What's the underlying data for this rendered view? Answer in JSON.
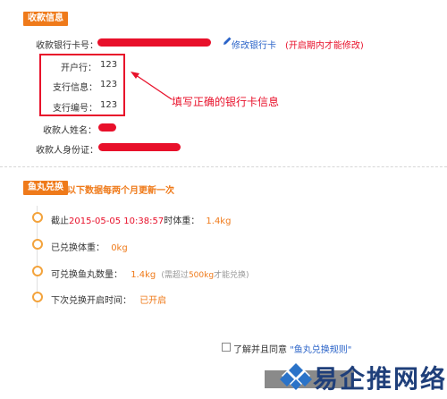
{
  "receiving_info": {
    "section_title": "收款信息",
    "bank_card_label": "收款银行卡号：",
    "modify_link": "修改银行卡",
    "modify_note": "(开启期内才能修改)",
    "bank_open_label": "开户行：",
    "bank_open_value": "123",
    "branch_info_label": "支行信息：",
    "branch_info_value": "123",
    "branch_code_label": "支行编号：",
    "branch_code_value": "123",
    "annotation": "填写正确的银行卡信息",
    "payee_name_label": "收款人姓名：",
    "payee_id_label": "收款人身份证："
  },
  "fish_exchange": {
    "section_title": "鱼丸兑换",
    "notice": "以下数据每两个月更新一次",
    "items": [
      {
        "prefix": "截止",
        "date": "2015-05-05 10:38:57",
        "mid": "时体重：",
        "value": "1.4kg"
      },
      {
        "label": "已兑换体重：",
        "value": "0kg"
      },
      {
        "label": "可兑换鱼丸数量：",
        "value": "1.4kg",
        "note_a": "(需超过",
        "note_b": "500kg",
        "note_c": "才能兑换)"
      },
      {
        "label": "下次兑换开启时间：",
        "value": "已开启"
      }
    ],
    "agree_text": "了解并且同意",
    "rules_link": "\"鱼丸兑换规则\""
  },
  "watermark": {
    "text": "易企推网络"
  },
  "colors": {
    "accent": "#ef7a1a",
    "redaction": "#e8102a",
    "link": "#2a63c8"
  }
}
